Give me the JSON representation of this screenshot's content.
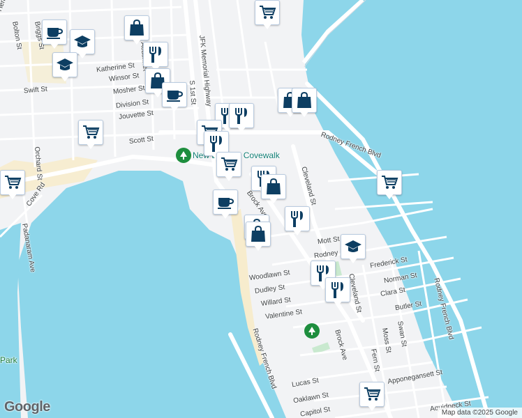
{
  "map": {
    "colors": {
      "water": "#8dd6ea",
      "land": "#f2f3f5",
      "road": "#ffffff",
      "beach": "#f7eccd",
      "park": "#c9e9cf",
      "marker_icon": "#0d3e62"
    },
    "streets": [
      {
        "label": "Hemlock St"
      },
      {
        "label": "Bolton St"
      },
      {
        "label": "Briggs St"
      },
      {
        "label": "Acushnet"
      },
      {
        "label": "JFK Memorial Highway"
      },
      {
        "label": "Katherine St"
      },
      {
        "label": "Winsor St"
      },
      {
        "label": "Swift St"
      },
      {
        "label": "Mosher St"
      },
      {
        "label": "Division St"
      },
      {
        "label": "Jouvette St"
      },
      {
        "label": "Scott St"
      },
      {
        "label": "S 1st St"
      },
      {
        "label": "Rodney French Blvd"
      },
      {
        "label": "Cleveland St"
      },
      {
        "label": "Brock Ave"
      },
      {
        "label": "Mott St"
      },
      {
        "label": "Rodney"
      },
      {
        "label": "Frederick St"
      },
      {
        "label": "Norman St"
      },
      {
        "label": "Clara St"
      },
      {
        "label": "Woodlawn St"
      },
      {
        "label": "Dudley St"
      },
      {
        "label": "Willard St"
      },
      {
        "label": "Valentine St"
      },
      {
        "label": "Butler St"
      },
      {
        "label": "Swan St"
      },
      {
        "label": "Moss St"
      },
      {
        "label": "Fern St"
      },
      {
        "label": "Apponegansett St"
      },
      {
        "label": "Lucas St"
      },
      {
        "label": "Oaklawn St"
      },
      {
        "label": "Capitol St"
      },
      {
        "label": "Aquidneck St"
      },
      {
        "label": "Padanaram Ave"
      },
      {
        "label": "Cove Rd"
      },
      {
        "label": "Orchard St"
      },
      {
        "label": "Park"
      },
      {
        "label": "Rodney French Blvd"
      },
      {
        "label": "Brock Ave"
      },
      {
        "label": "Rodney French Blvd"
      },
      {
        "label": "Cleveland St"
      },
      {
        "label": "Mosher St"
      }
    ],
    "poi_label": "New Bedford Covewalk",
    "markers": [
      {
        "type": "grocery"
      },
      {
        "type": "cafe"
      },
      {
        "type": "school"
      },
      {
        "type": "school"
      },
      {
        "type": "shopping"
      },
      {
        "type": "restaurant"
      },
      {
        "type": "shopping"
      },
      {
        "type": "cafe"
      },
      {
        "type": "grocery"
      },
      {
        "type": "shopping"
      },
      {
        "type": "shopping"
      },
      {
        "type": "restaurant"
      },
      {
        "type": "restaurant"
      },
      {
        "type": "grocery"
      },
      {
        "type": "restaurant"
      },
      {
        "type": "grocery"
      },
      {
        "type": "restaurant"
      },
      {
        "type": "shopping"
      },
      {
        "type": "shopping"
      },
      {
        "type": "cafe"
      },
      {
        "type": "restaurant"
      },
      {
        "type": "shopping"
      },
      {
        "type": "school"
      },
      {
        "type": "restaurant"
      },
      {
        "type": "restaurant"
      },
      {
        "type": "grocery"
      },
      {
        "type": "grocery"
      },
      {
        "type": "grocery"
      }
    ],
    "branding": "Google",
    "attribution": "Map data ©2025 Google"
  }
}
